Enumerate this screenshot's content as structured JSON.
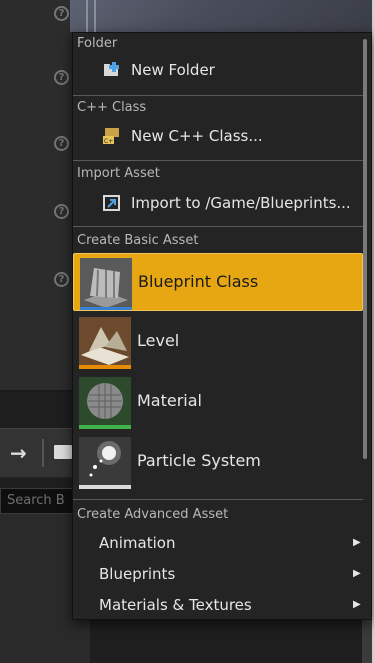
{
  "menu": {
    "sections": {
      "folder": "Folder",
      "cpp": "C++ Class",
      "import": "Import Asset",
      "basic": "Create Basic Asset",
      "advanced": "Create Advanced Asset"
    },
    "items": {
      "new_folder": "New Folder",
      "new_cpp": "New C++ Class...",
      "import_to": "Import to /Game/Blueprints..."
    },
    "basic_assets": [
      {
        "label": "Blueprint Class",
        "icon": "blueprint-class-icon",
        "highlighted": true
      },
      {
        "label": "Level",
        "icon": "level-icon"
      },
      {
        "label": "Material",
        "icon": "material-icon"
      },
      {
        "label": "Particle System",
        "icon": "particle-system-icon"
      }
    ],
    "advanced_submenus": [
      {
        "label": "Animation"
      },
      {
        "label": "Blueprints"
      },
      {
        "label": "Materials & Textures"
      }
    ],
    "submenu_arrow": "▶"
  },
  "background": {
    "search_placeholder": "Search B",
    "help_glyph": "?",
    "back_arrow": "→"
  },
  "colors": {
    "highlight": "#e7a712",
    "level_underline": "#e48b08",
    "material_underline": "#3fb34a"
  }
}
